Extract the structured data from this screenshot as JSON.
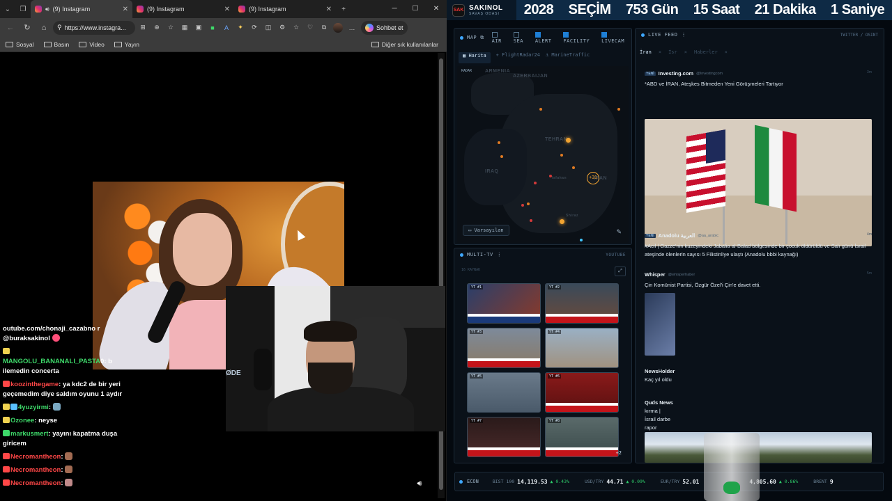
{
  "browser": {
    "tabs": [
      {
        "title": "(9) Instagram",
        "active": true
      },
      {
        "title": "(9) Instagram",
        "active": false
      },
      {
        "title": "(9) Instagram",
        "active": false
      }
    ],
    "url": "https://www.instagra...",
    "copilot_label": "Sohbet et",
    "bookmarks": [
      "Sosyal",
      "Basın",
      "Video",
      "Yayın"
    ],
    "other_bookmarks": "Diğer sık kullanılanlar"
  },
  "chat": [
    {
      "user": "",
      "text": "outube.com/chonaji_cazabno r",
      "color": "#ffffff"
    },
    {
      "user": "",
      "text": "@buraksakinol",
      "color": "#ffffff"
    },
    {
      "user": "MANGOLU_BANANALI_PASTA",
      "text": "0: b ilemedin concerta",
      "color": "#3ed96a"
    },
    {
      "user": "koozinthegame",
      "text": ": ya kdc2 de bir yeri geçemedim diye saldım oyunu 1 aydır",
      "color": "#ff4747"
    },
    {
      "user": "4yuzyirmi",
      "text": ":",
      "color": "#3ed96a"
    },
    {
      "user": "Ozonee",
      "text": ": neyse",
      "color": "#3ed96a"
    },
    {
      "user": "markusmert",
      "text": ": yayını kapatma duşa giricem",
      "color": "#3ed96a"
    },
    {
      "user": "Necromantheon",
      "text": ":",
      "color": "#ff4747"
    },
    {
      "user": "Necromantheon",
      "text": ":",
      "color": "#ff4747"
    },
    {
      "user": "Necromantheon",
      "text": ":",
      "color": "#ff4747"
    }
  ],
  "dashboard": {
    "brand_name": "SAKINOL",
    "brand_sub": "SAVAŞ ODASI",
    "brand_logo": "SAK",
    "countdown": [
      "2028",
      "SEÇİM",
      "753 Gün",
      "15 Saat",
      "21 Dakika",
      "1 Saniye"
    ],
    "map": {
      "title": "MAP",
      "filters": [
        {
          "label": "AIR",
          "checked": false
        },
        {
          "label": "SEA",
          "checked": false
        },
        {
          "label": "ALERT",
          "checked": true
        },
        {
          "label": "FACILITY",
          "checked": true
        },
        {
          "label": "LIVECAM",
          "checked": true
        }
      ],
      "tabs": [
        "Harita",
        "FlightRadar24",
        "MarineTraffic"
      ],
      "radar_label": "RADAR",
      "labels": [
        "ARMENIA",
        "AZERBAIJAN",
        "TEHRAN",
        "IRAQ",
        "IRAN",
        "Isfahan",
        "Shiraz"
      ],
      "cluster": "+31",
      "default_button": "Varsayılan"
    },
    "tv": {
      "title": "MULTI-TV",
      "source": "YOUTUBE",
      "count": "16 KAYNAK",
      "labels": [
        "YT #1",
        "YT #2",
        "YT #3",
        "YT #4",
        "YT #5",
        "YT #6",
        "YT #7",
        "YT #8"
      ],
      "more": "+2"
    },
    "feed": {
      "title": "LIVE FEED",
      "right": "TWITTER / OSINT",
      "tabs": [
        "İran",
        "İsr",
        "Haberler"
      ],
      "items": [
        {
          "tag": "YENİ",
          "source": "Investing.com",
          "handle": "@Investingcom",
          "time": "3m",
          "text": "*ABD ve İRAN, Ateşkes Bitmeden Yeni Görüşmeleri Tartıyor"
        },
        {
          "tag": "YENİ",
          "source": "Anadolu العربية",
          "handle": "@aa_arabic",
          "time": "4m",
          "text": "#Acil | Gazze'nin kuzeyindeki Jabalia al-Balad bölgesinde bir çocuk öldürüldü ve Salı günü İsrail ateşinde ölenlerin sayısı 5 Filistinliye ulaştı (Anadolu bbbi kaynağı)"
        },
        {
          "tag": "",
          "source": "Whisper",
          "handle": "@whisperhaber",
          "time": "5m",
          "text": "Çin Komünist Partisi, Özgür Özel'i Çin'e davet etti."
        },
        {
          "tag": "",
          "source": "NewsHolder",
          "handle": "",
          "time": "",
          "text": "Kaç yıl oldu"
        },
        {
          "tag": "",
          "source": "Quds News",
          "handle": "",
          "time": "",
          "text": "kırma | İsrail darbe rapor"
        }
      ]
    },
    "cam_overlay": "ØDE",
    "econ": {
      "title": "ECON",
      "quotes": [
        {
          "name": "BIST 100",
          "value": "14,119.53",
          "change": "▲ 0.43%"
        },
        {
          "name": "USD/TRY",
          "value": "44.71",
          "change": "▲ 0.09%"
        },
        {
          "name": "EUR/TRY",
          "value": "52.01",
          "change": ""
        },
        {
          "name": "",
          "value": "4,805.60",
          "change": "▲ 0.86%"
        },
        {
          "name": "BRENT",
          "value": "9",
          "change": ""
        }
      ]
    }
  },
  "colors": {
    "accent": "#3fa8ff",
    "banner_bg": "#0e2a45",
    "up": "#2ecb6a",
    "alert": "#ff4747"
  }
}
